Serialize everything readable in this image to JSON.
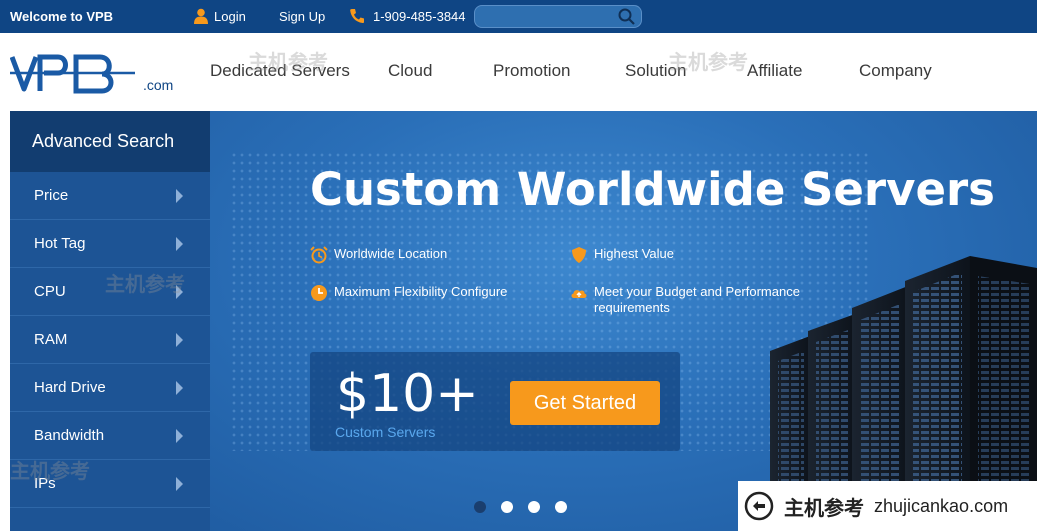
{
  "topbar": {
    "welcome": "Welcome to VPB",
    "login": "Login",
    "signup": "Sign Up",
    "phone": "1-909-485-3844",
    "search_placeholder": ""
  },
  "header": {
    "logo_text": "VPB",
    "logo_suffix": ".com",
    "nav": [
      "Dedicated Servers",
      "Cloud",
      "Promotion",
      "Solution",
      "Affiliate",
      "Company"
    ]
  },
  "sidebar": {
    "title": "Advanced Search",
    "items": [
      "Price",
      "Hot Tag",
      "CPU",
      "RAM",
      "Hard Drive",
      "Bandwidth",
      "IPs"
    ]
  },
  "hero": {
    "title": "Custom Worldwide Servers",
    "features": [
      {
        "icon": "alarm-clock-icon",
        "text": "Worldwide Location"
      },
      {
        "icon": "shield-icon",
        "text": "Highest Value"
      },
      {
        "icon": "clock-icon",
        "text": "Maximum Flexibility Configure"
      },
      {
        "icon": "cloud-upload-icon",
        "text": "Meet your Budget and Performance requirements"
      }
    ],
    "price": "$10+",
    "price_sub": "Custom Servers",
    "cta": "Get Started",
    "slides": 4,
    "active_slide": 1
  },
  "watermark": {
    "logo_text": "主机参考",
    "domain": "zhujicankao.com",
    "faint_repeat": "主机参考"
  },
  "colors": {
    "topbar": "#0f4584",
    "sidebar": "#1d5495",
    "sidebar_header": "#123d70",
    "hero": "#2a6fb8",
    "cta": "#f7991c",
    "price_sub": "#5aa8ee"
  }
}
